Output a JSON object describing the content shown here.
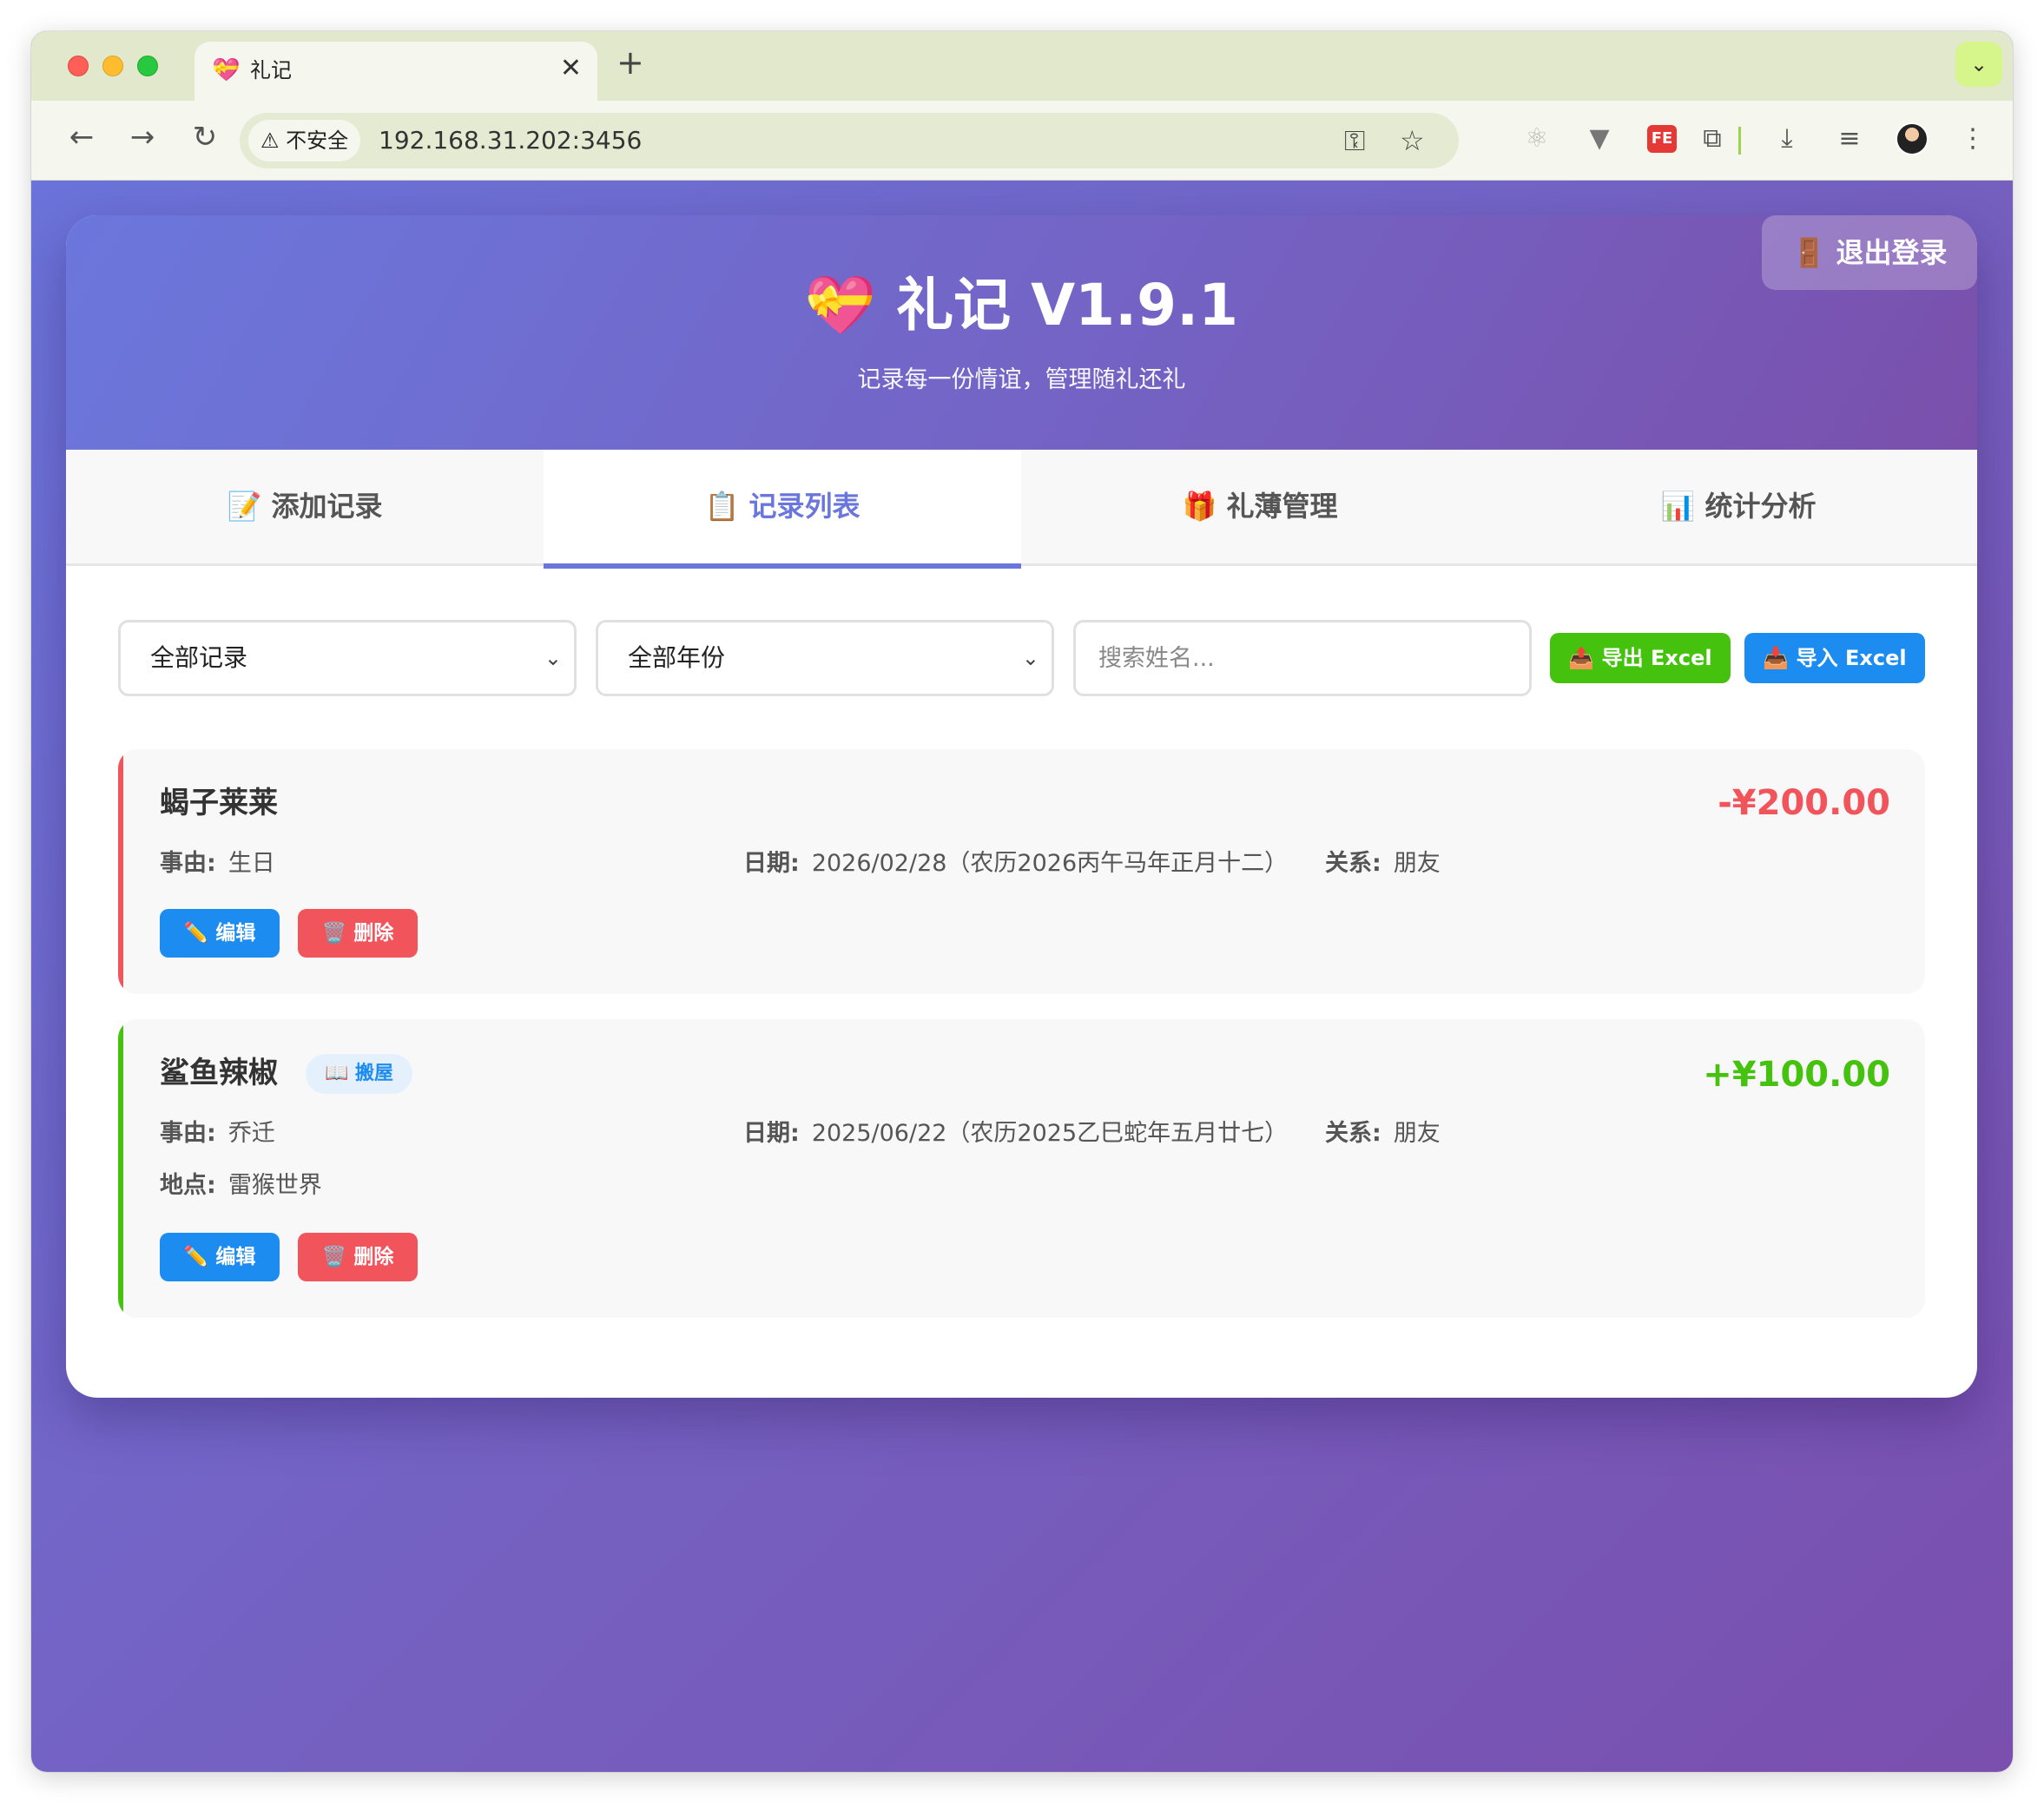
{
  "browser": {
    "tab_title": "礼记",
    "tab_icon": "💝",
    "security_label": "不安全",
    "url": "192.168.31.202:3456"
  },
  "app": {
    "logout_label": "🚪 退出登录",
    "title_icon": "💝",
    "title": "礼记 V1.9.1",
    "subtitle": "记录每一份情谊，管理随礼还礼",
    "tabs": [
      {
        "label": "📝 添加记录"
      },
      {
        "label": "📋 记录列表"
      },
      {
        "label": "🎁 礼薄管理"
      },
      {
        "label": "📊 统计分析"
      }
    ],
    "filters": {
      "type_value": "全部记录",
      "year_value": "全部年份",
      "search_placeholder": "搜索姓名...",
      "export_label": "📤 导出 Excel",
      "import_label": "📥 导入 Excel"
    },
    "records": [
      {
        "name": "蝎子莱莱",
        "tag": "",
        "amount": "-¥200.00",
        "amount_color": "#f2545c",
        "reason_label": "事由:",
        "reason": "生日",
        "date_label": "日期:",
        "date": "2026/02/28（农历2026丙午马年正月十二）",
        "relation_label": "关系:",
        "relation": "朋友",
        "edit_label": "✏️ 编辑",
        "delete_label": "🗑️ 删除"
      },
      {
        "name": "鲨鱼辣椒",
        "tag": "📖 搬屋",
        "amount": "+¥100.00",
        "amount_color": "#44c20e",
        "reason_label": "事由:",
        "reason": "乔迁",
        "date_label": "日期:",
        "date": "2025/06/22（农历2025乙巳蛇年五月廿七）",
        "relation_label": "关系:",
        "relation": "朋友",
        "location_label": "地点:",
        "location": "雷猴世界",
        "edit_label": "✏️ 编辑",
        "delete_label": "🗑️ 删除"
      }
    ]
  }
}
